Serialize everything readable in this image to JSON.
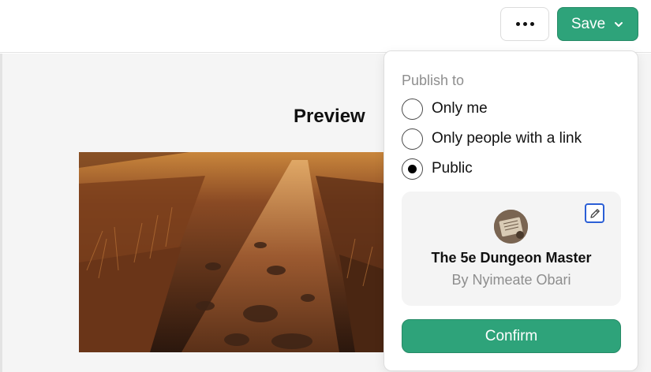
{
  "header": {
    "more_icon": "ellipsis-icon",
    "save_label": "Save",
    "save_icon": "chevron-down-icon"
  },
  "preview": {
    "title": "Preview"
  },
  "publish": {
    "label": "Publish to",
    "options": [
      {
        "label": "Only me",
        "selected": false
      },
      {
        "label": "Only people with a link",
        "selected": false
      },
      {
        "label": "Public",
        "selected": true
      }
    ]
  },
  "gpt_card": {
    "name": "The 5e Dungeon Master",
    "author": "By Nyimeate Obari",
    "edit_icon": "pencil-icon"
  },
  "confirm_label": "Confirm",
  "colors": {
    "accent": "#2ea37a",
    "edit_outline": "#2b5fd6"
  }
}
